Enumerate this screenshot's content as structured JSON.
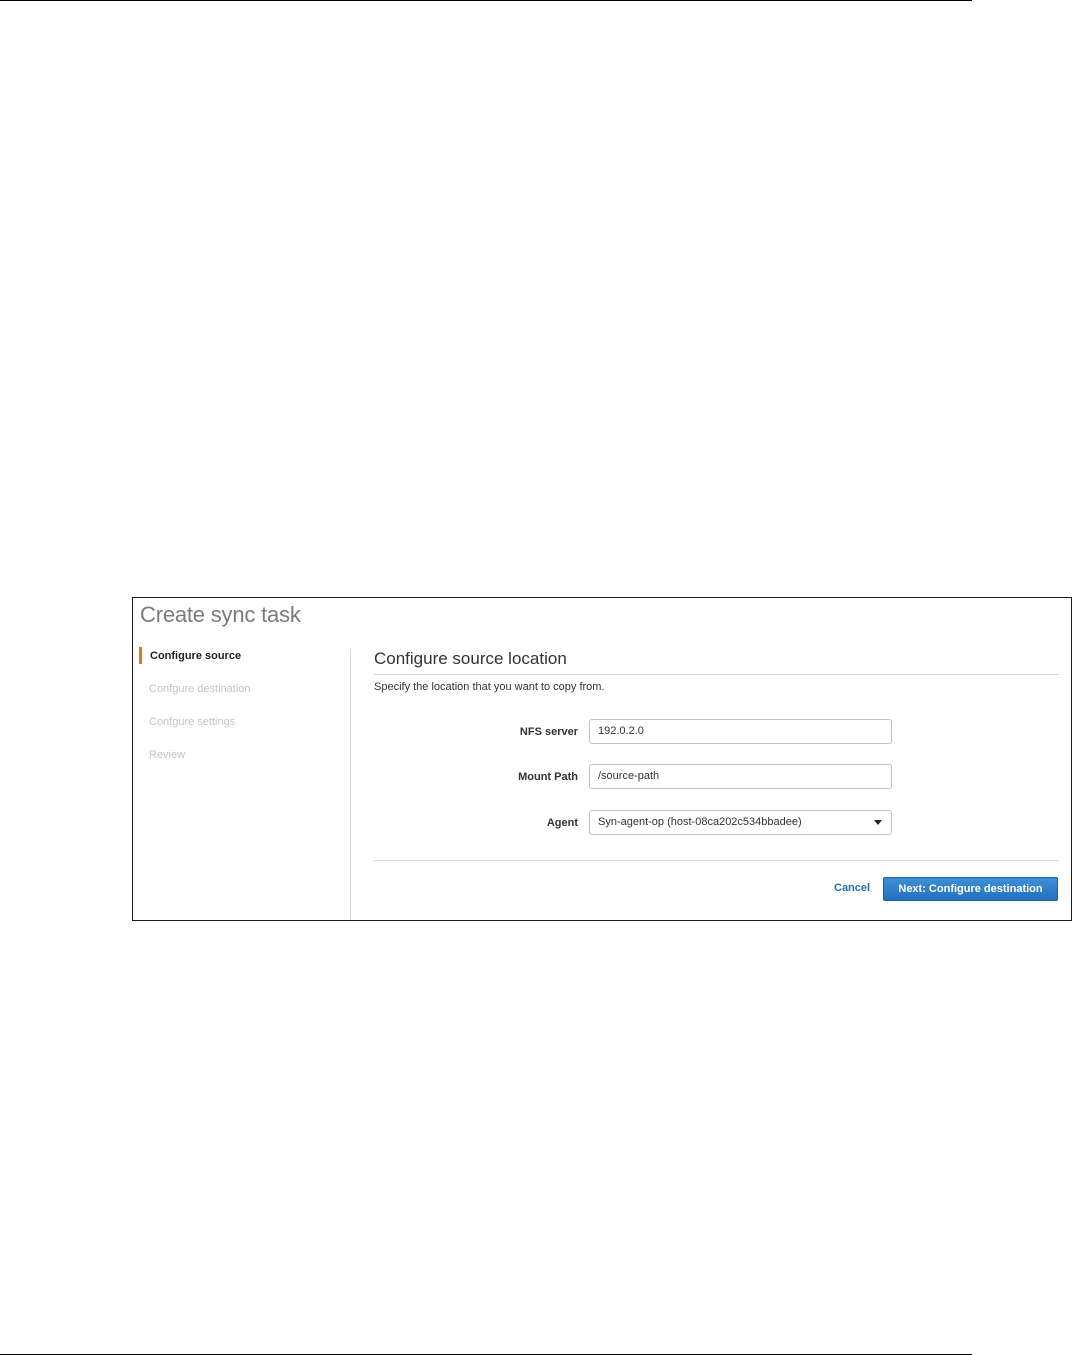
{
  "wizard": {
    "title": "Create sync task",
    "steps": [
      {
        "label": "Configure source",
        "active": true
      },
      {
        "label": "Confgure destination",
        "active": false
      },
      {
        "label": "Confgure settings",
        "active": false
      },
      {
        "label": "Review",
        "active": false
      }
    ]
  },
  "panel": {
    "heading": "Configure source location",
    "description": "Specify the location that you want to copy from.",
    "fields": {
      "nfs_server": {
        "label": "NFS server",
        "value": "192.0.2.0"
      },
      "mount_path": {
        "label": "Mount Path",
        "value": "/source-path"
      },
      "agent": {
        "label": "Agent",
        "value": "Syn-agent-op (host-08ca202c534bbadee)"
      }
    }
  },
  "actions": {
    "cancel_label": "Cancel",
    "next_label": "Next: Configure destination"
  },
  "colors": {
    "active_step_accent": "#e07b18",
    "link": "#1f6fb5",
    "primary_button": "#2271bf"
  },
  "icons": {
    "agent_select": "caret-down-icon"
  }
}
